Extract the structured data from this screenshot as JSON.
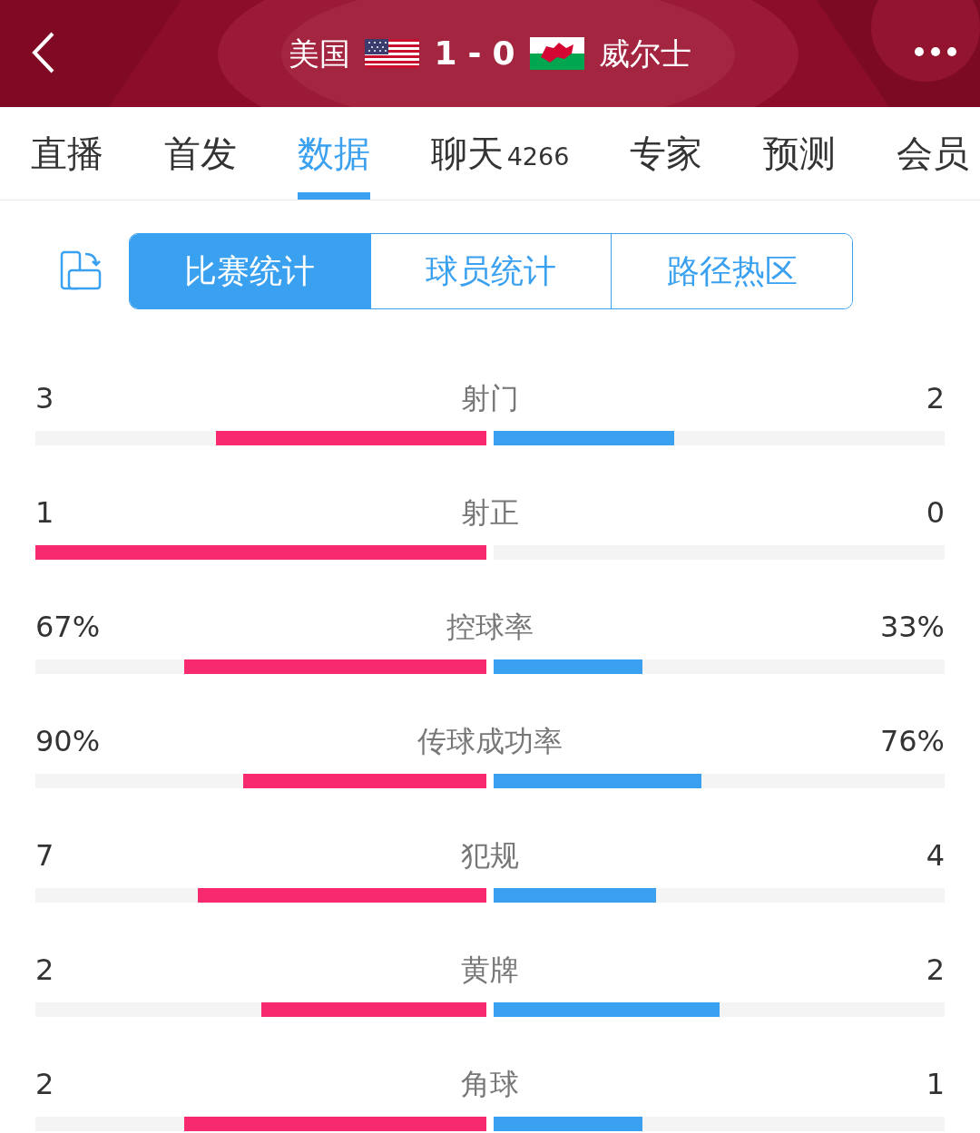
{
  "header": {
    "home": "美国",
    "score_home": "1",
    "score_sep": "-",
    "score_away": "0",
    "away": "威尔士"
  },
  "tabs": [
    {
      "label": "直播",
      "selected": false
    },
    {
      "label": "首发",
      "selected": false
    },
    {
      "label": "数据",
      "selected": true
    },
    {
      "label": "聊天",
      "count": "4266",
      "selected": false
    },
    {
      "label": "专家",
      "selected": false
    },
    {
      "label": "预测",
      "selected": false
    },
    {
      "label": "会员",
      "selected": false
    }
  ],
  "segments": [
    {
      "label": "比赛统计",
      "selected": true
    },
    {
      "label": "球员统计",
      "selected": false
    },
    {
      "label": "路径热区",
      "selected": false
    }
  ],
  "stats": [
    {
      "name": "射门",
      "home": "3",
      "away": "2",
      "bars": [
        {
          "level": 0.6
        },
        {
          "level": 0.4
        }
      ]
    },
    {
      "name": "射正",
      "home": "1",
      "away": "0",
      "bars": [
        {
          "level": 1
        },
        {
          "level": 0
        }
      ]
    },
    {
      "name": "控球率",
      "home": "67%",
      "away": "33%",
      "bars": [
        {
          "level": 0.67
        },
        {
          "level": 0.33
        }
      ]
    },
    {
      "name": "传球成功率",
      "home": "90%",
      "away": "76%",
      "bars": [
        {
          "level": 0.54
        },
        {
          "level": 0.46
        }
      ]
    },
    {
      "name": "犯规",
      "home": "7",
      "away": "4",
      "bars": [
        {
          "level": 0.64
        },
        {
          "level": 0.36
        }
      ]
    },
    {
      "name": "黄牌",
      "home": "2",
      "away": "2",
      "bars": [
        {
          "level": 0.5
        },
        {
          "level": 0.5
        }
      ]
    },
    {
      "name": "角球",
      "home": "2",
      "away": "1",
      "bars": [
        {
          "level": 0.67
        },
        {
          "level": 0.33
        }
      ]
    }
  ]
}
